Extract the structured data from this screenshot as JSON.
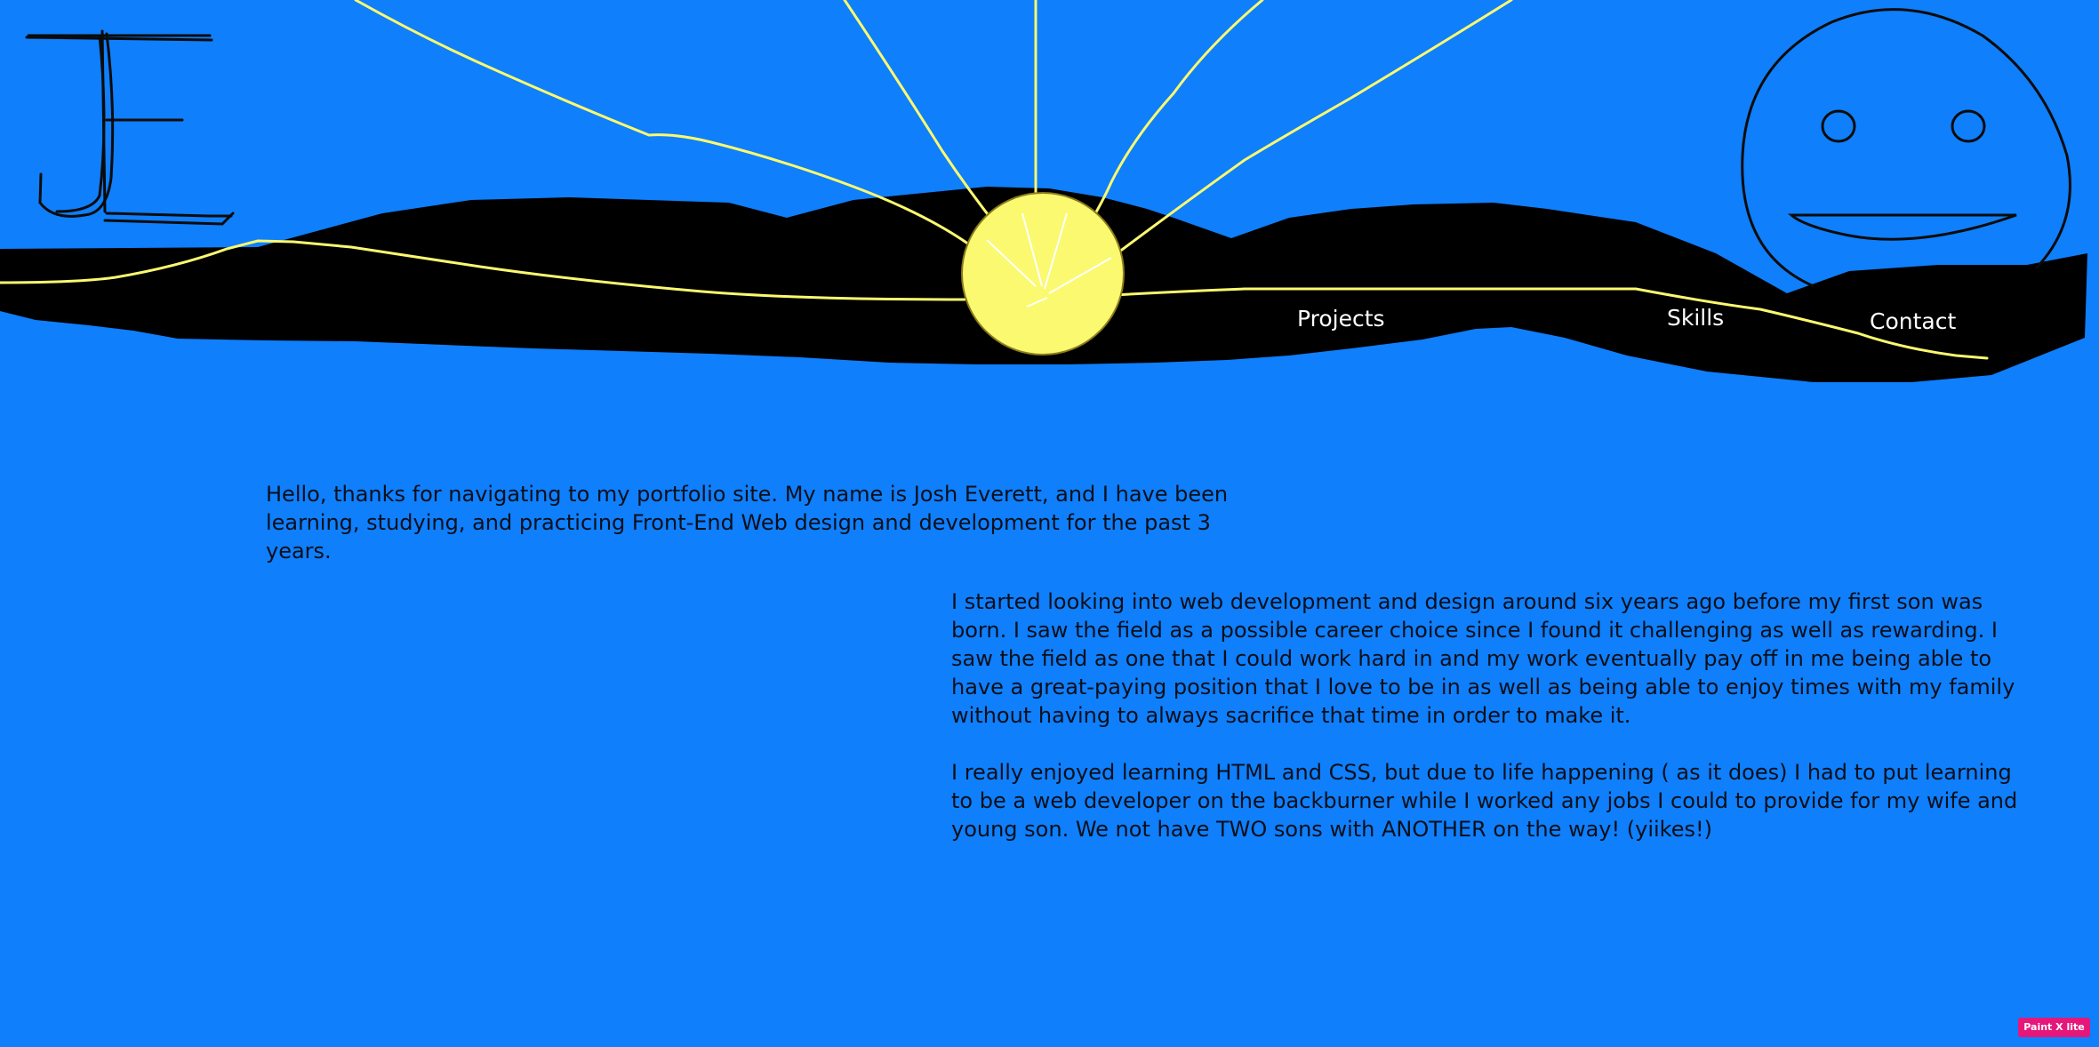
{
  "nav": {
    "projects": "Projects",
    "skills": "Skills",
    "contact": "Contact"
  },
  "content": {
    "intro": "Hello, thanks for navigating to my portfolio site. My name is Josh Everett, and I have been learning, studying, and practicing Front-End Web design and development for the past 3 years.",
    "about_1": "I started looking into web development and design around six years ago before my first son was born. I saw the field as a possible career choice since I found it challenging as well as rewarding. I saw the field as one that I could work hard in and my work eventually pay off in me being able to have a great-paying position that I love to be in as well as being able to enjoy times with my family without having to always sacrifice that time in order to make it.",
    "about_2": "I really enjoyed learning HTML and CSS, but due to life happening ( as it does) I had to put learning to be a web developer on the backburner while I worked any jobs I could to provide for my wife and young son. We not have TWO sons with ANOTHER on the way! (yiikes!)"
  },
  "watermark": "Paint X lite",
  "colors": {
    "background": "#0f7ffb",
    "landscape": "#000000",
    "sun": "#fbf96f",
    "nav_text": "#ffffff",
    "body_text": "#0b0f1a"
  }
}
